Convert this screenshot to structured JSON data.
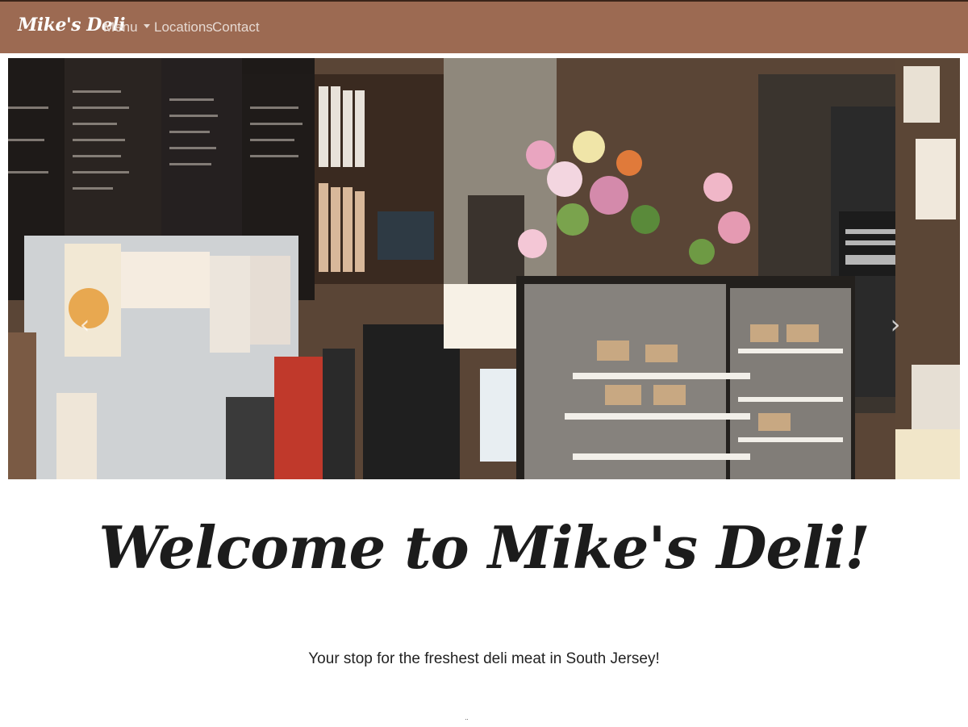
{
  "navbar": {
    "brand": "Mike's Deli",
    "items": [
      {
        "label": "Menu",
        "has_dropdown": true
      },
      {
        "label": "Locations"
      },
      {
        "label": "Contact"
      }
    ],
    "background_color": "#9c6a52"
  },
  "hero": {
    "image_description_icon": "cafe-counter-photo",
    "carousel_prev": "‹",
    "carousel_next": "›"
  },
  "main": {
    "heading": "Welcome to Mike's Deli!",
    "tagline": "Your stop for the freshest deli meat in South Jersey!",
    "scroll_indicator": "¨"
  }
}
